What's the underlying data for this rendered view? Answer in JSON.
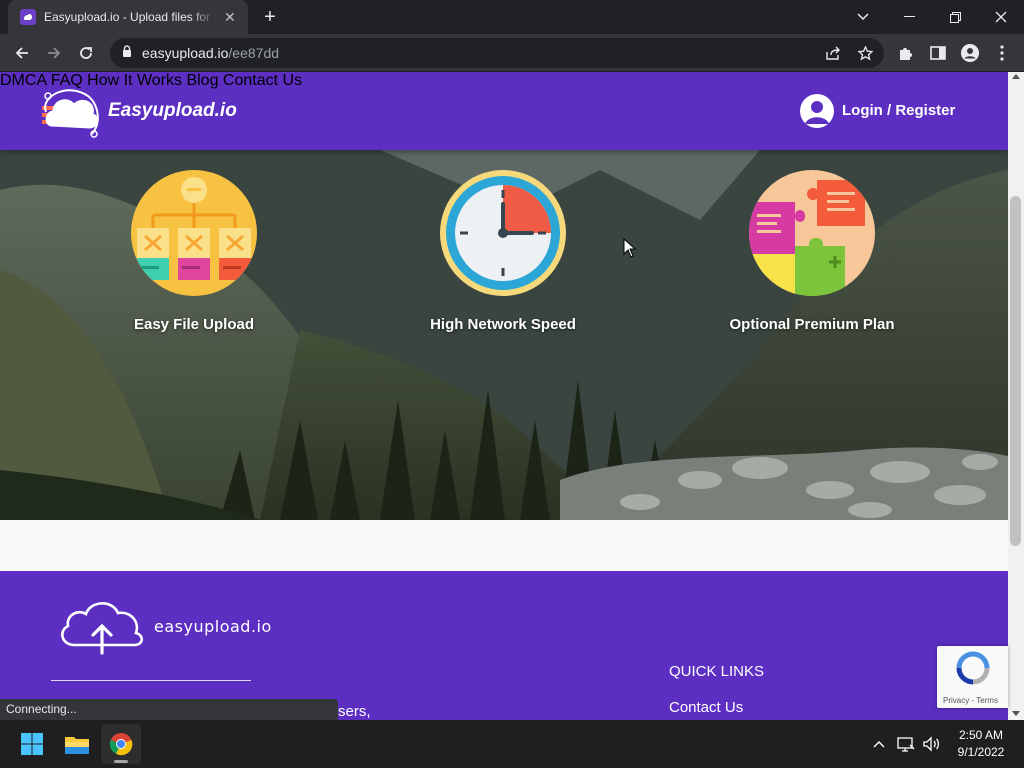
{
  "browser": {
    "tab_title": "Easyupload.io - Upload files for free",
    "url_host": "easyupload.io",
    "url_path": "/ee87dd",
    "status_text": "Connecting..."
  },
  "site": {
    "logo_text": "Easyupload.io",
    "nav": [
      "DMCA",
      "FAQ",
      "How It Works",
      "Blog",
      "Contact Us"
    ],
    "login_label": "Login / Register",
    "brand_color": "#5c2fc2"
  },
  "features": [
    {
      "caption": "Easy File Upload",
      "icon": "flowchart-icon"
    },
    {
      "caption": "High Network Speed",
      "icon": "clock-icon"
    },
    {
      "caption": "Optional Premium Plan",
      "icon": "puzzle-icon"
    }
  ],
  "footer": {
    "logo_text": "easyupload.io",
    "text_fragment": "sers,",
    "quick_links_title": "QUICK LINKS",
    "quick_links": [
      "Contact Us"
    ]
  },
  "recaptcha": {
    "links": "Privacy - Terms"
  },
  "taskbar": {
    "time": "2:50 AM",
    "date": "9/1/2022"
  }
}
